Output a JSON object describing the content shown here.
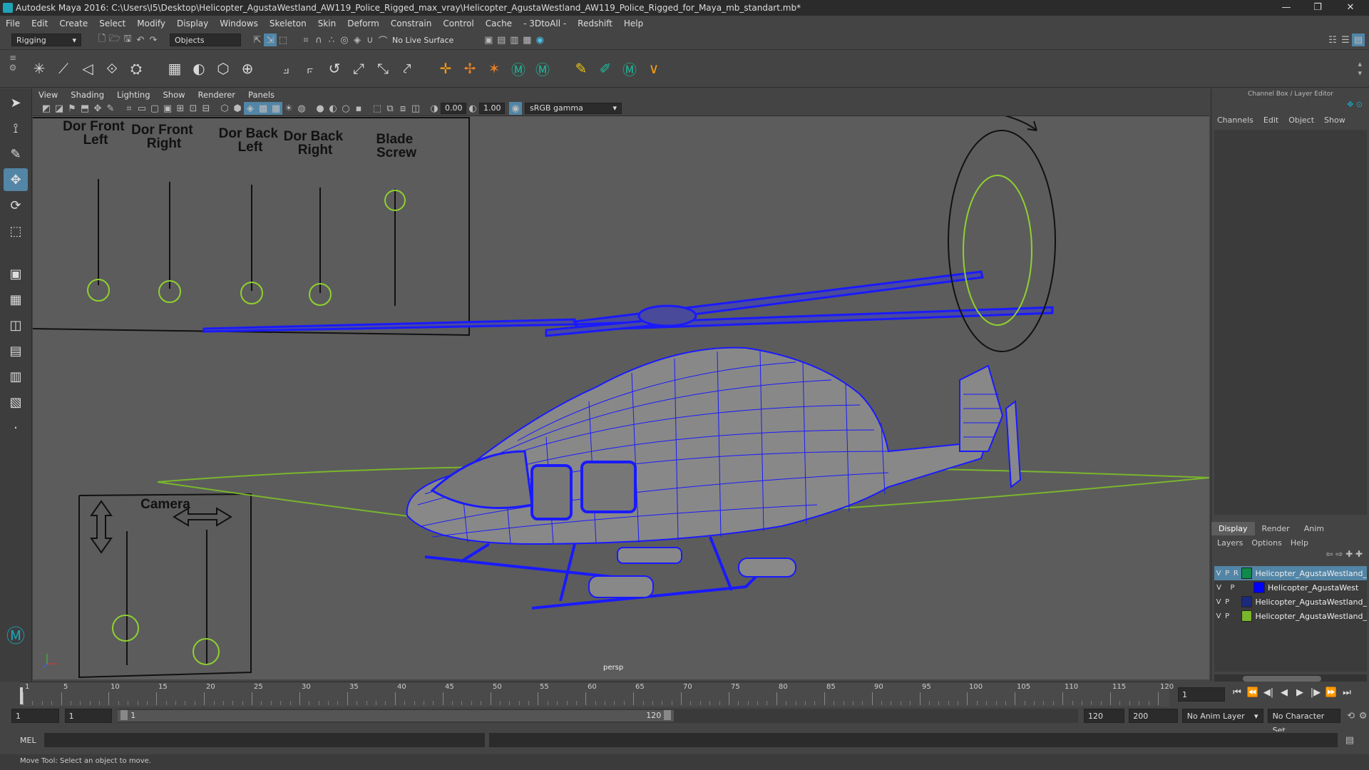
{
  "window": {
    "title": "Autodesk Maya 2016: C:\\Users\\I5\\Desktop\\Helicopter_AgustaWestland_AW119_Police_Rigged_max_vray\\Helicopter_AgustaWestland_AW119_Police_Rigged_for_Maya_mb_standart.mb*",
    "minimize": "—",
    "restore": "❐",
    "close": "✕"
  },
  "menubar": [
    "File",
    "Edit",
    "Create",
    "Select",
    "Modify",
    "Display",
    "Windows",
    "Skeleton",
    "Skin",
    "Deform",
    "Constrain",
    "Control",
    "Cache",
    "- 3DtoAll -",
    "Redshift",
    "Help"
  ],
  "statusline": {
    "mode": "Rigging",
    "objects_field": "Objects",
    "live_surface": "No Live Surface"
  },
  "viewport_menu": [
    "View",
    "Shading",
    "Lighting",
    "Show",
    "Renderer",
    "Panels"
  ],
  "viewport_toolbar": {
    "exposure": "0.00",
    "gamma": "1.00",
    "colorspace": "sRGB gamma"
  },
  "viewport": {
    "camera_label": "persp",
    "controls": {
      "door_front_left": "Dor Front Left",
      "door_front_right": "Dor Front Right",
      "door_back_left": "Dor Back Left",
      "door_back_right": "Dor Back Right",
      "blade_screw": "Blade Screw",
      "camera": "Camera"
    },
    "colors": {
      "wire": "#1a1aff",
      "ground": "#7ab62c",
      "controller": "#8fd12f",
      "bg": "#5c5c5c"
    }
  },
  "channel_box": {
    "header": "Channel Box / Layer Editor",
    "menu": [
      "Channels",
      "Edit",
      "Object",
      "Show"
    ]
  },
  "layer_editor": {
    "tabs": [
      "Display",
      "Render",
      "Anim"
    ],
    "menu": [
      "Layers",
      "Options",
      "Help"
    ],
    "layers": [
      {
        "v": "V",
        "p": "P",
        "r": "R",
        "color": "#0f8a4a",
        "name": "Helicopter_AgustaWestland_",
        "selected": true
      },
      {
        "v": "V",
        "p": "P",
        "r": "",
        "color": "#0000ff",
        "name": "Helicopter_AgustaWest",
        "selected": false
      },
      {
        "v": "V",
        "p": "P",
        "r": "",
        "color": "#1b2a7a",
        "name": "Helicopter_AgustaWestland_",
        "selected": false
      },
      {
        "v": "V",
        "p": "P",
        "r": "",
        "color": "#7ab62c",
        "name": "Helicopter_AgustaWestland_",
        "selected": false
      }
    ]
  },
  "timeline": {
    "ticks": [
      "1",
      "5",
      "10",
      "15",
      "20",
      "25",
      "30",
      "35",
      "40",
      "45",
      "50",
      "55",
      "60",
      "65",
      "70",
      "75",
      "80",
      "85",
      "90",
      "95",
      "100",
      "105",
      "110",
      "115",
      "120"
    ],
    "current_frame": "1"
  },
  "range": {
    "start": "1",
    "playback_start": "1",
    "slider_start": "1",
    "slider_end": "120",
    "playback_end": "120",
    "end": "200",
    "anim_layer": "No Anim Layer",
    "character_set": "No Character Set"
  },
  "cmdline": {
    "lang": "MEL"
  },
  "helpline": {
    "text": "Move Tool: Select an object to move."
  }
}
